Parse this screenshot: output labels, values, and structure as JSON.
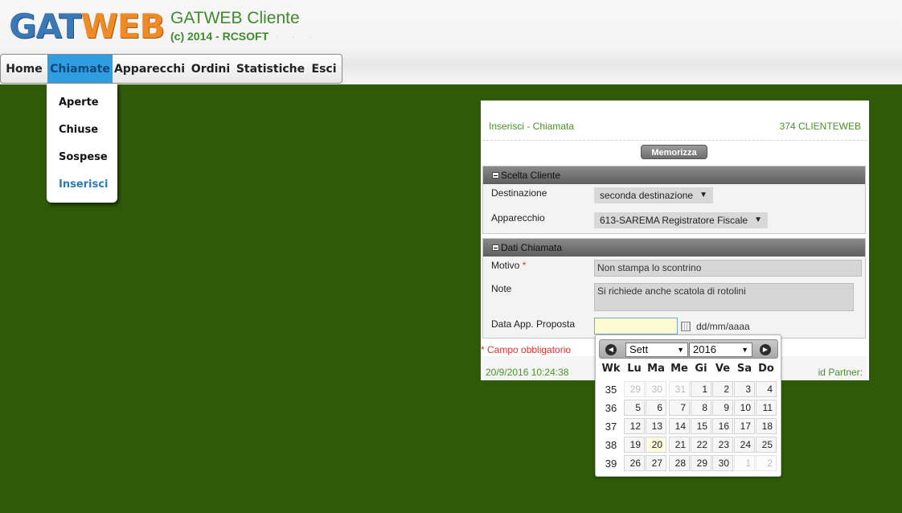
{
  "header": {
    "logo_part1": "GAT",
    "logo_part2": "WEB",
    "title": "GATWEB Cliente",
    "subtitle": "(c) 2014 - RCSOFT",
    "dots": "· · ·"
  },
  "menu": {
    "items": [
      "Home",
      "Chiamate",
      "Apparecchi",
      "Ordini",
      "Statistiche",
      "Esci"
    ],
    "active": "Chiamate",
    "submenu": [
      "Aperte",
      "Chiuse",
      "Sospese",
      "Inserisci"
    ],
    "submenu_current": "Inserisci"
  },
  "panel": {
    "title": "Inserisci - Chiamata",
    "client": "374 CLIENTEWEB",
    "save_label": "Memorizza",
    "section_client": {
      "title": "Scelta Cliente",
      "destinazione_label": "Destinazione",
      "destinazione_value": "seconda destinazione",
      "apparecchio_label": "Apparecchio",
      "apparecchio_value": "613-SAREMA Registratore Fiscale"
    },
    "section_call": {
      "title": "Dati Chiamata",
      "motivo_label": "Motivo",
      "required_mark": "*",
      "motivo_value": "Non stampa lo scontrino",
      "note_label": "Note",
      "note_value": "Si richiede anche scatola di rotolini",
      "date_label": "Data App. Proposta",
      "date_value": "",
      "date_format": "dd/mm/aaaa"
    },
    "required_note": "* Campo obbligatorio",
    "timestamp": "20/9/2016 10:24:38",
    "partner_label": "id Partner:"
  },
  "calendar": {
    "month": "Sett",
    "year": "2016",
    "headers": [
      "Wk",
      "Lu",
      "Ma",
      "Me",
      "Gi",
      "Ve",
      "Sa",
      "Do"
    ],
    "weeks": [
      {
        "wk": "35",
        "days": [
          {
            "d": "29",
            "m": true
          },
          {
            "d": "30",
            "m": true
          },
          {
            "d": "31",
            "m": true
          },
          {
            "d": "1"
          },
          {
            "d": "2"
          },
          {
            "d": "3"
          },
          {
            "d": "4"
          }
        ]
      },
      {
        "wk": "36",
        "days": [
          {
            "d": "5"
          },
          {
            "d": "6"
          },
          {
            "d": "7"
          },
          {
            "d": "8"
          },
          {
            "d": "9"
          },
          {
            "d": "10"
          },
          {
            "d": "11"
          }
        ]
      },
      {
        "wk": "37",
        "days": [
          {
            "d": "12"
          },
          {
            "d": "13"
          },
          {
            "d": "14"
          },
          {
            "d": "15"
          },
          {
            "d": "16"
          },
          {
            "d": "17"
          },
          {
            "d": "18"
          }
        ]
      },
      {
        "wk": "38",
        "days": [
          {
            "d": "19"
          },
          {
            "d": "20",
            "h": true
          },
          {
            "d": "21"
          },
          {
            "d": "22"
          },
          {
            "d": "23"
          },
          {
            "d": "24"
          },
          {
            "d": "25"
          }
        ]
      },
      {
        "wk": "39",
        "days": [
          {
            "d": "26"
          },
          {
            "d": "27"
          },
          {
            "d": "28"
          },
          {
            "d": "29"
          },
          {
            "d": "30"
          },
          {
            "d": "1",
            "m": true
          },
          {
            "d": "2",
            "m": true
          }
        ]
      }
    ]
  }
}
